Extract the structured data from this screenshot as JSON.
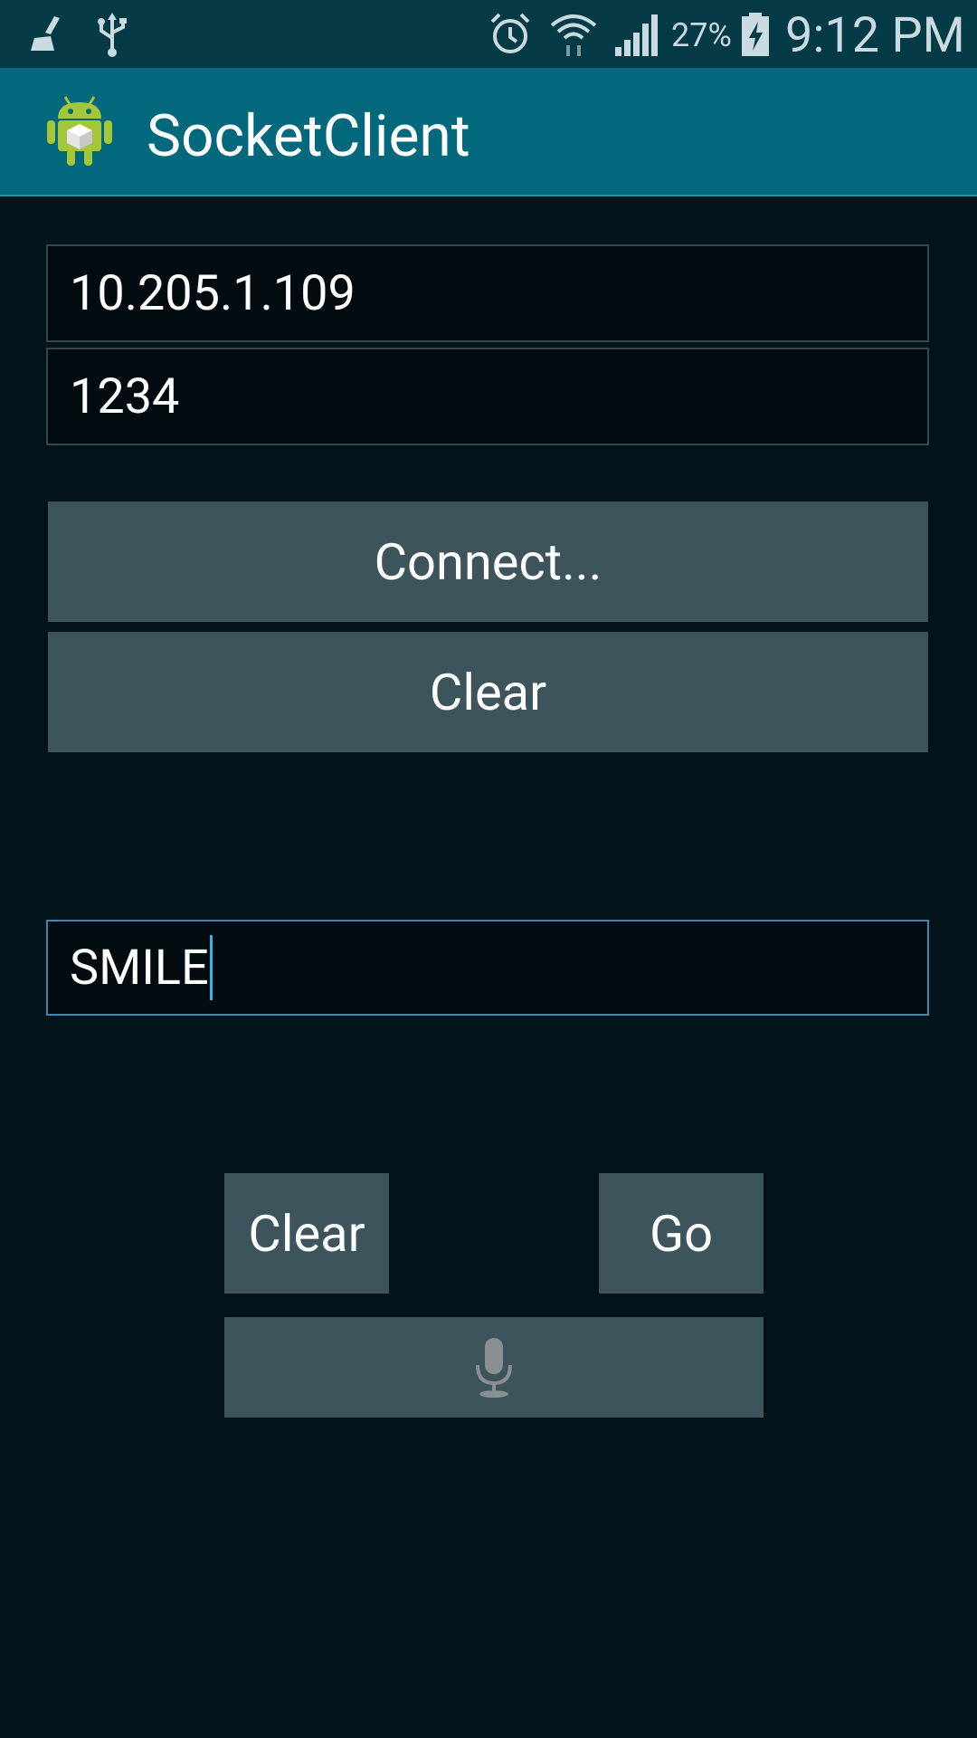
{
  "status_bar": {
    "icons": [
      "broom-icon",
      "usb-icon",
      "alarm-icon",
      "wifi-icon",
      "signal-icon",
      "battery-charging-icon"
    ],
    "battery_percent": "27%",
    "time": "9:12 PM"
  },
  "action_bar": {
    "title": "SocketClient",
    "icon": "android-app-icon"
  },
  "form": {
    "ip_value": "10.205.1.109",
    "port_value": "1234",
    "connect_label": "Connect...",
    "clear_label": "Clear",
    "message_value": "SMILE",
    "clear_message_label": "Clear",
    "go_label": "Go",
    "mic_icon": "microphone-icon"
  },
  "colors": {
    "status_bar_bg": "#033a45",
    "action_bar_bg": "#02687b",
    "background": "#02131a",
    "button_bg": "#3d545c",
    "focus_border": "#3f86b2",
    "caret": "#33b5e5"
  }
}
